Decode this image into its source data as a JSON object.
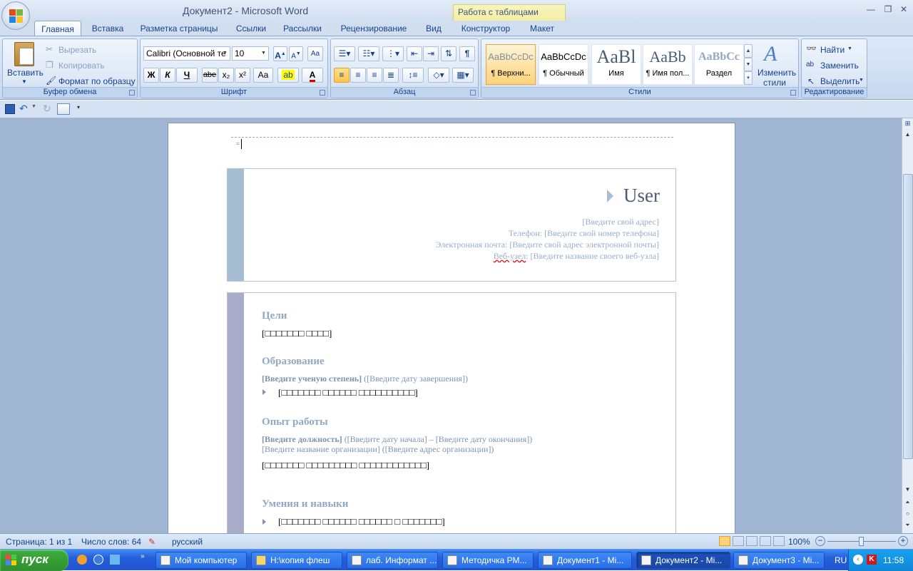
{
  "window": {
    "title": "Документ2 - Microsoft Word",
    "context_tab": "Работа с таблицами"
  },
  "tabs": [
    "Главная",
    "Вставка",
    "Разметка страницы",
    "Ссылки",
    "Рассылки",
    "Рецензирование",
    "Вид",
    "Конструктор",
    "Макет"
  ],
  "ribbon": {
    "clipboard": {
      "label": "Буфер обмена",
      "paste": "Вставить",
      "cut": "Вырезать",
      "copy": "Копировать",
      "format_painter": "Формат по образцу"
    },
    "font": {
      "label": "Шрифт",
      "font_name": "Calibri (Основной те",
      "font_size": "10",
      "bold": "Ж",
      "italic": "К",
      "underline": "Ч",
      "strike": "abe",
      "subscript": "x₂",
      "superscript": "x²",
      "change_case": "Aa"
    },
    "paragraph": {
      "label": "Абзац"
    },
    "styles": {
      "label": "Стили",
      "items": [
        {
          "sample": "AaBbCcDc",
          "name": "¶ Верхни..."
        },
        {
          "sample": "AaBbCcDc",
          "name": "¶ Обычный"
        },
        {
          "sample": "AaBl",
          "name": "Имя"
        },
        {
          "sample": "AaBb",
          "name": "¶ Имя пол..."
        },
        {
          "sample": "AaBbCc",
          "name": "Раздел"
        }
      ],
      "change_styles_1": "Изменить",
      "change_styles_2": "стили"
    },
    "editing": {
      "label": "Редактирование",
      "find": "Найти",
      "replace": "Заменить",
      "select": "Выделить"
    }
  },
  "document": {
    "name": "User",
    "address": "[Введите свой адрес]",
    "phone": "Телефон: [Введите свой номер телефона]",
    "email": "Электронная почта: [Введите свой адрес электронной почты]",
    "web_label": "Веб-узел",
    "web": ": [Введите название своего веб-узла]",
    "goals_title": "Цели",
    "goals_text": "[□□□□□□□ □□□□]",
    "edu_title": "Образование",
    "edu_degree": "[Введите ученую степень]",
    "edu_date": " ([Введите дату завершения])",
    "edu_bullet": "[□□□□□□□ □□□□□□ □□□□□□□□□□]",
    "work_title": "Опыт работы",
    "work_position": "[Введите должность]",
    "work_dates": " ([Введите дату начала] – [Введите дату окончания])",
    "work_org": "[Введите название организации] ([Введите адрес организации])",
    "work_text": "[□□□□□□□ □□□□□□□□□ □□□□□□□□□□□□]",
    "skills_title": "Умения и навыки",
    "skills_bullet": "[□□□□□□□ □□□□□□ □□□□□□ □ □□□□□□□]"
  },
  "status": {
    "page": "Страница: 1 из 1",
    "words": "Число слов: 64",
    "language": "русский",
    "zoom": "100%"
  },
  "taskbar": {
    "start": "пуск",
    "items": [
      {
        "label": "Мой компьютер"
      },
      {
        "label": "H:\\копия флеш"
      },
      {
        "label": "лаб. Информат ..."
      },
      {
        "label": "Методичка РМ..."
      },
      {
        "label": "Документ1 - Mi..."
      },
      {
        "label": "Документ2 - Mi..."
      },
      {
        "label": "Документ3 - Mi..."
      }
    ],
    "lang": "RU",
    "clock": "11:58"
  },
  "colors": {
    "ribbon": "#dde9f8",
    "accent_blue": "#15428b",
    "sidebar_top": "#a6bdd2",
    "sidebar_bottom": "#a9acc9",
    "taskbar": "#245edc",
    "start": "#3dae3d"
  }
}
